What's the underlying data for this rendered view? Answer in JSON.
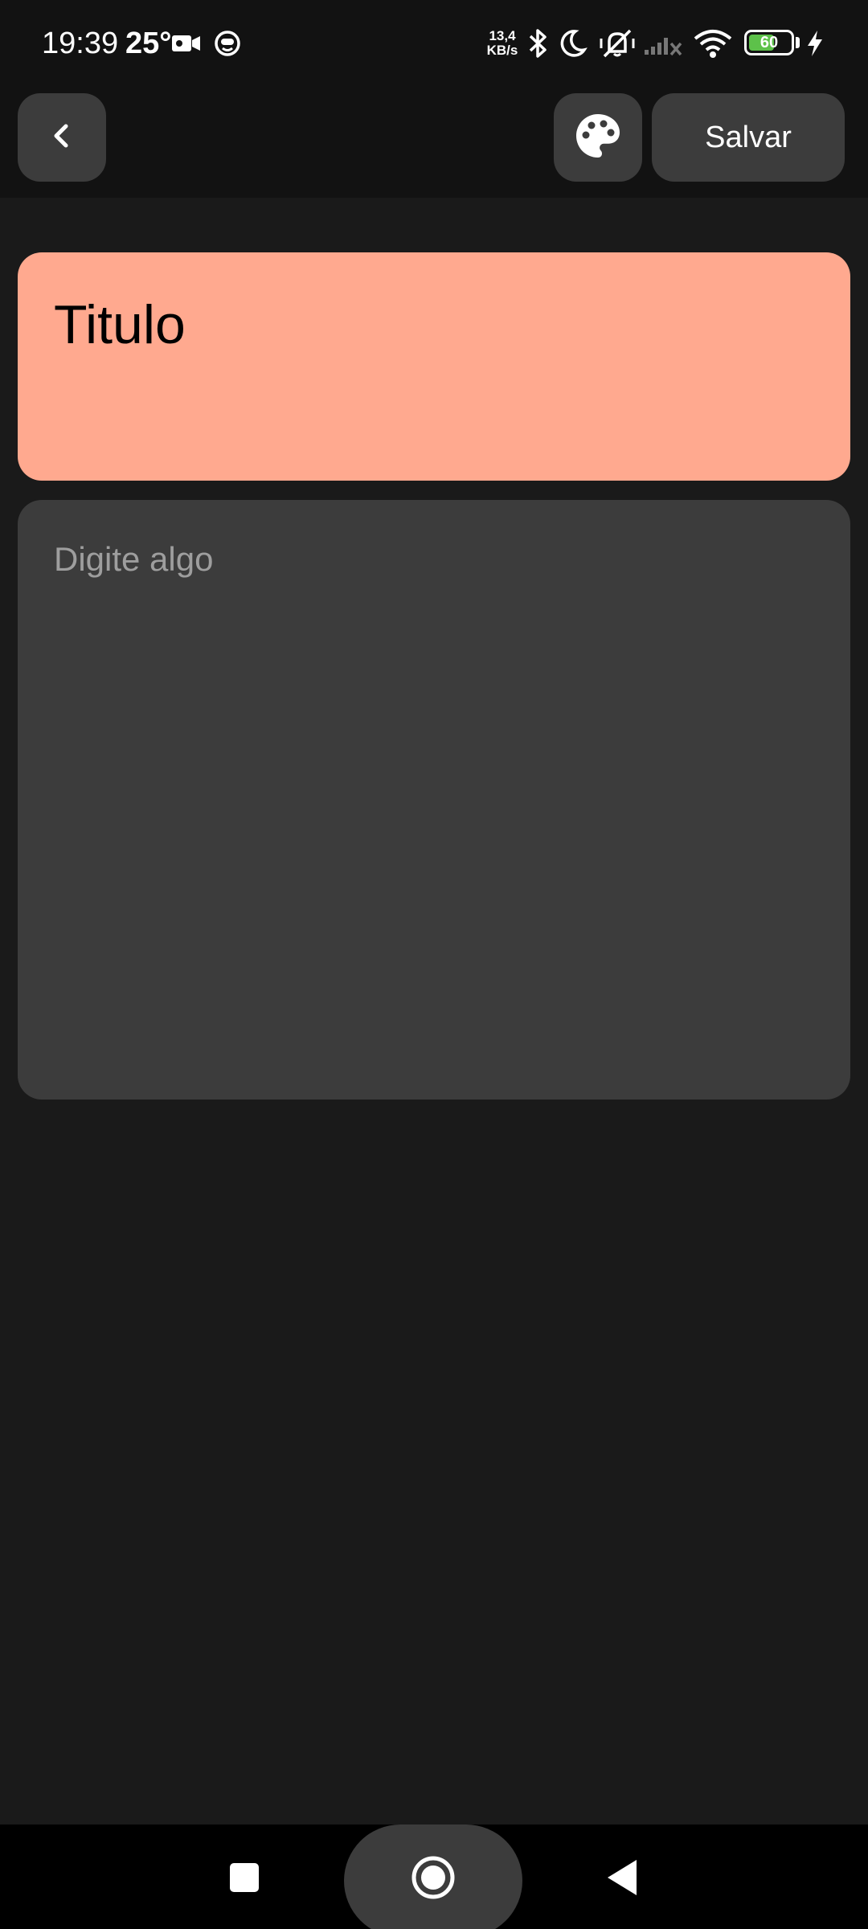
{
  "status_bar": {
    "time": "19:39",
    "temperature": "25°",
    "net_speed_value": "13,4",
    "net_speed_unit": "KB/s",
    "battery_level": "60",
    "icons": [
      "video-camera-icon",
      "face-icon",
      "bluetooth-icon",
      "moon-icon",
      "vibrate-muted-icon",
      "signal-off-icon",
      "wifi-icon",
      "battery-icon",
      "charging-bolt-icon"
    ]
  },
  "header": {
    "back_icon": "chevron-left-icon",
    "palette_icon": "palette-icon",
    "save_label": "Salvar"
  },
  "editor": {
    "title_value": "Titulo",
    "title_color": "#ffa98f",
    "body_placeholder": "Digite algo",
    "body_color": "#3c3c3c"
  },
  "nav_bar": {
    "icons": [
      "recents-square-icon",
      "home-circle-icon",
      "back-triangle-icon"
    ]
  },
  "colors": {
    "background": "#1a1a1a",
    "header_background": "#121212",
    "button_background": "#3c3c3c",
    "battery_fill": "#5dc14a"
  }
}
